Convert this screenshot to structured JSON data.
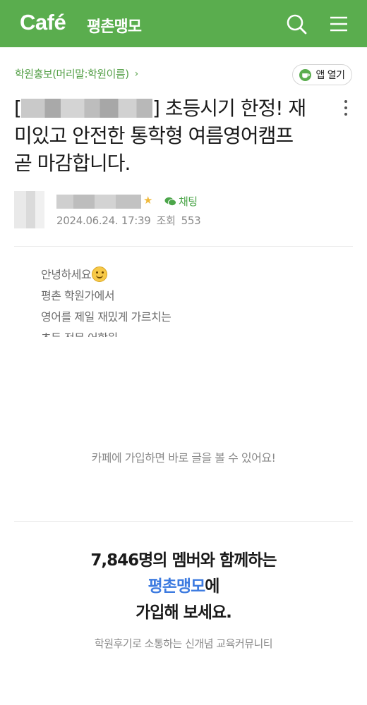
{
  "header": {
    "logo": "Café",
    "cafe_name": "평촌맹모",
    "icons": [
      "search-icon",
      "menu-icon"
    ]
  },
  "post": {
    "board": "학원홍보(머리말:학원이름)",
    "board_chevron": "›",
    "app_open": "앱 열기",
    "title_prefix": "[",
    "title_line1": "] 초등시기 한정! 재",
    "title_line2": "미있고 안전한 통학형 여름영어캠프",
    "title_line3": "곧 마감합니다.",
    "chat_label": "채팅",
    "date": "2024.06.24. 17:39",
    "views_label": "조회",
    "views": "553",
    "preview_lines": [
      "안녕하세요",
      "평촌 학원가에서",
      "영어를 제일 재밌게 가르치는",
      "초등 전문 어학원"
    ]
  },
  "join_message": "카페에 가입하면 바로 글을 볼 수 있어요!",
  "promo": {
    "line1": "7,846명의 멤버와 함께하는",
    "cafe_name": "평촌맹모",
    "line2_suffix": "에",
    "line3": "가입해 보세요.",
    "sub": "학원후기로 소통하는 신개념 교육커뮤니티"
  },
  "colors": {
    "brand_green": "#5aad4e",
    "link_green": "#57a14a",
    "accent_blue": "#3d7be0"
  }
}
